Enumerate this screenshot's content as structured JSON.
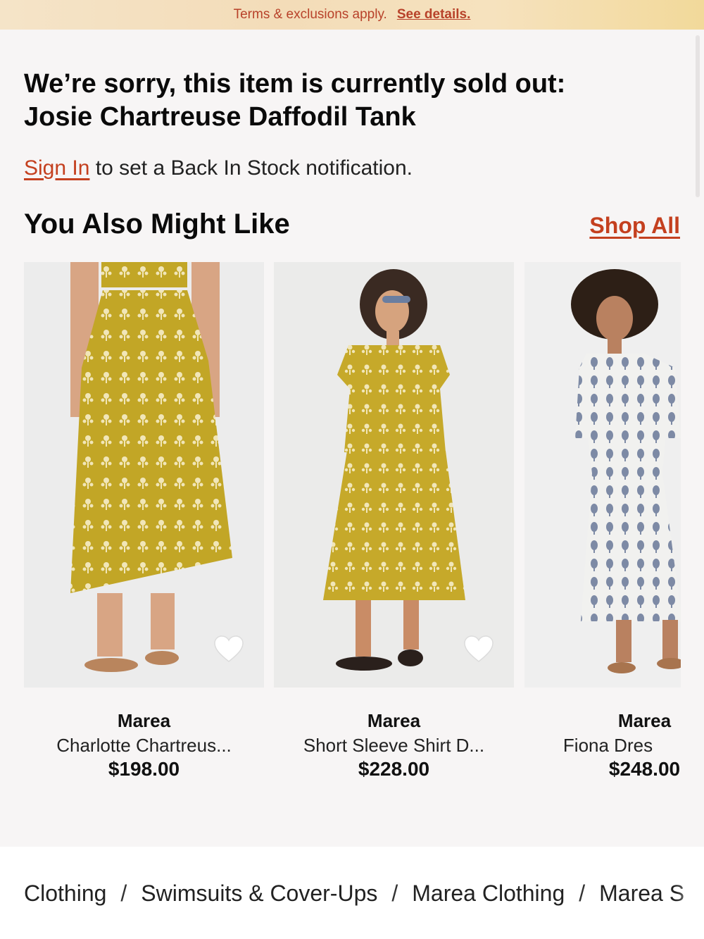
{
  "promo": {
    "terms": "Terms & exclusions apply.",
    "details_link": "See details."
  },
  "headline": {
    "line1": "We’re sorry, this item is currently sold out:",
    "line2": "Josie Chartreuse Daffodil Tank"
  },
  "notify": {
    "sign_in": "Sign In",
    "rest": " to set a Back In Stock notification."
  },
  "recommendations": {
    "title": "You Also Might Like",
    "shop_all": "Shop All",
    "products": [
      {
        "brand": "Marea",
        "name": "Charlotte Chartreus...",
        "price": "$198.00",
        "icon": "heart-icon"
      },
      {
        "brand": "Marea",
        "name": "Short Sleeve Shirt D...",
        "price": "$228.00",
        "icon": "heart-icon"
      },
      {
        "brand": "Marea",
        "name": "Fiona Dres",
        "price": "$248.00",
        "icon": "heart-icon"
      }
    ]
  },
  "breadcrumb": {
    "items": [
      "Clothing",
      "Swimsuits & Cover-Ups",
      "Marea Clothing",
      "Marea S"
    ],
    "separator": "/"
  },
  "colors": {
    "accent": "#c4401f",
    "chartreuse": "#c2a626",
    "background": "#f7f5f5"
  }
}
